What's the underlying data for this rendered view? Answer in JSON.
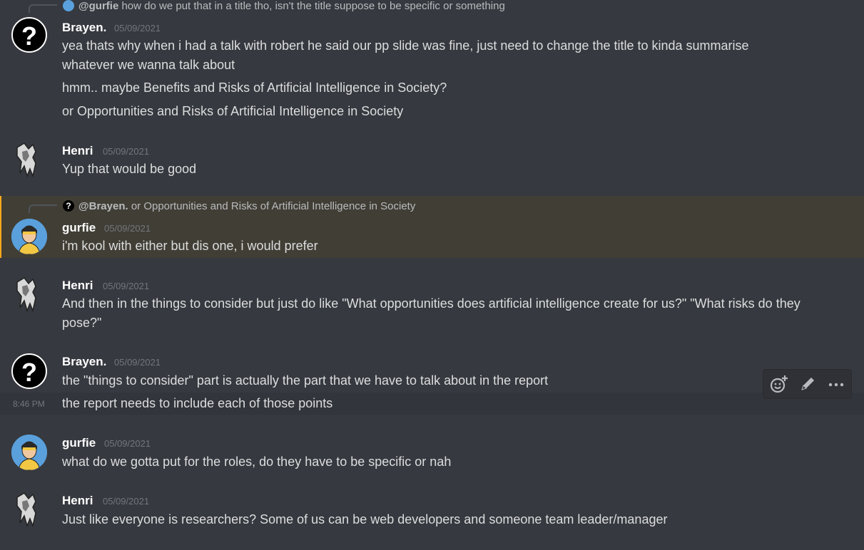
{
  "messages": [
    {
      "reply_to": "@gurfie",
      "reply_text": "how do we put that in a title tho, isn't the title suppose to be specific or something",
      "author": "Brayen.",
      "timestamp": "05/09/2021",
      "lines": [
        "yea thats why when i had a talk with robert he said our pp slide was fine, just need to change the title to kinda summarise whatever we wanna talk about",
        "hmm.. maybe Benefits and Risks of Artificial Intelligence in Society?",
        "or Opportunities and Risks of Artificial Intelligence in Society"
      ]
    },
    {
      "author": "Henri",
      "timestamp": "05/09/2021",
      "lines": [
        "Yup that would be good"
      ]
    },
    {
      "reply_to": "@Brayen.",
      "reply_text": "or Opportunities and Risks of Artificial Intelligence in Society",
      "author": "gurfie",
      "timestamp": "05/09/2021",
      "lines": [
        "i'm kool with either but dis one, i would prefer"
      ]
    },
    {
      "author": "Henri",
      "timestamp": "05/09/2021",
      "lines": [
        "And then in the things to consider but just do like \"What opportunities does artificial intelligence create for us?\" \"What risks do they pose?\""
      ]
    },
    {
      "author": "Brayen.",
      "timestamp": "05/09/2021",
      "lines": [
        "the \"things to consider\" part is actually the part that we have to talk about in the report",
        "the report needs to include each of those points"
      ],
      "hover_time": "8:46 PM"
    },
    {
      "author": "gurfie",
      "timestamp": "05/09/2021",
      "lines": [
        "what do we gotta put for the roles, do they have to be specific or nah"
      ]
    },
    {
      "author": "Henri",
      "timestamp": "05/09/2021",
      "lines": [
        "Just like everyone is researchers? Some of us can be web developers and someone team leader/manager"
      ]
    }
  ],
  "avatar_glyph": "?",
  "colors": {
    "background": "#36393f",
    "highlight_bg": "#413e35",
    "highlight_bar": "#faa81a",
    "hover_bg": "#32353b",
    "toolbar_bg": "#2f3136"
  },
  "icons": {
    "react": "add-reaction-icon",
    "edit": "edit-pencil-icon",
    "more": "more-dots-icon"
  }
}
